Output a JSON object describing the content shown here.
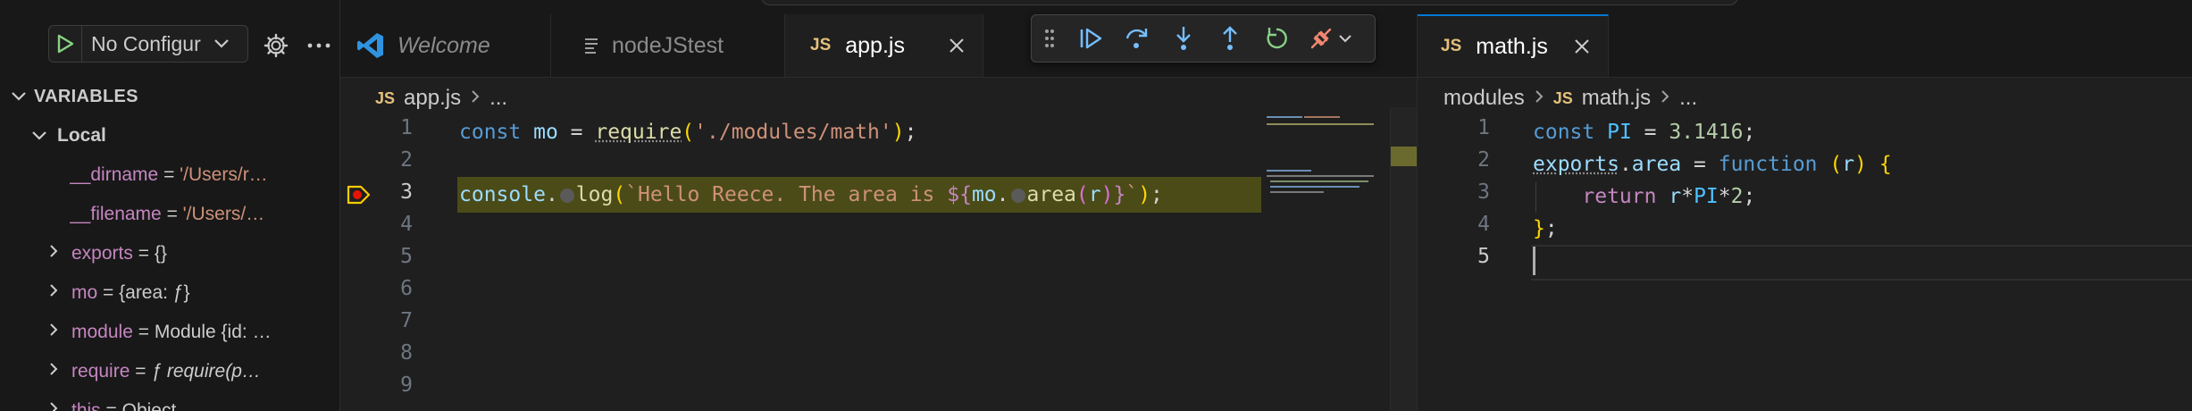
{
  "sidebar": {
    "run_config": "No Configur",
    "variables_header": "VARIABLES",
    "local_header": "Local",
    "variables": [
      {
        "name": "__dirname",
        "eq": " = ",
        "value": "'/Users/r…",
        "kind": "str"
      },
      {
        "name": "__filename",
        "eq": " = ",
        "value": "'/Users/…",
        "kind": "str"
      },
      {
        "name": "exports",
        "eq": " = ",
        "value": "{}",
        "kind": "obj"
      },
      {
        "name": "mo",
        "eq": " = ",
        "value": "{area: ƒ}",
        "kind": "obj"
      },
      {
        "name": "module",
        "eq": " = ",
        "value": "Module {id: …",
        "kind": "obj"
      },
      {
        "name": "require",
        "eq": " = ",
        "value": "ƒ require(p…",
        "kind": "fn"
      },
      {
        "name": "this",
        "eq": " = ",
        "value": "Object",
        "kind": "obj"
      }
    ]
  },
  "editor_left": {
    "tabs": [
      {
        "label": "Welcome",
        "italic": true
      },
      {
        "label": "nodeJStest"
      },
      {
        "label": "app.js",
        "badge": "JS"
      }
    ],
    "breadcrumb": {
      "badge": "JS",
      "file": "app.js",
      "more": "..."
    },
    "line_numbers": [
      "1",
      "2",
      "3",
      "4",
      "5",
      "6",
      "7",
      "8",
      "9"
    ],
    "current_line": "3",
    "code": {
      "l1_const": "const",
      "l1_mo": "mo",
      "l1_eq": " = ",
      "l1_require": "require",
      "l1_path": "'./modules/math'",
      "l3_console": "console",
      "l3_log": "log",
      "l3_tpl_start": "`Hello Reece. The area is ",
      "l3_mo": "mo",
      "l3_area": "area",
      "l3_r": "r",
      "l3_tpl_end": "`"
    }
  },
  "editor_right": {
    "tab": {
      "label": "math.js",
      "badge": "JS"
    },
    "breadcrumb": {
      "folder": "modules",
      "badge": "JS",
      "file": "math.js",
      "more": "..."
    },
    "line_numbers": [
      "1",
      "2",
      "3",
      "4",
      "5"
    ],
    "current_line": "5",
    "code": {
      "l1_const": "const",
      "l1_pi": "PI",
      "l1_val": "3.1416",
      "l2_exports": "exports",
      "l2_area": "area",
      "l2_function": "function",
      "l2_r": "r",
      "l3_return": "return",
      "l3_r": "r",
      "l3_pi": "PI",
      "l3_two": "2"
    }
  },
  "colors": {
    "accent": "#0078d4",
    "debug_line": "#4b4b18",
    "js_badge": "#e5c07b"
  }
}
